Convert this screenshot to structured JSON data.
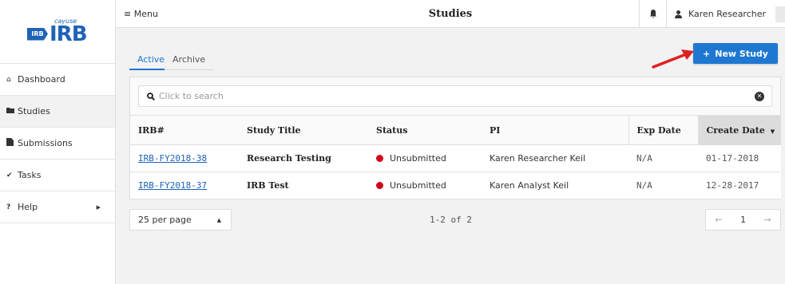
{
  "brand": {
    "tag": "IRB",
    "main": "IRB",
    "sub": "cayuse"
  },
  "sidebar": {
    "items": [
      {
        "label": "Dashboard",
        "icon": "home-icon"
      },
      {
        "label": "Studies",
        "icon": "folder-icon"
      },
      {
        "label": "Submissions",
        "icon": "document-icon"
      },
      {
        "label": "Tasks",
        "icon": "check-icon"
      },
      {
        "label": "Help",
        "icon": "question-icon"
      }
    ]
  },
  "header": {
    "menu_label": "Menu",
    "title": "Studies",
    "user_name": "Karen Researcher"
  },
  "tabs": {
    "active": "Active",
    "archive": "Archive"
  },
  "new_study_label": "New Study",
  "search": {
    "placeholder": "Click to search"
  },
  "table": {
    "headers": [
      "IRB#",
      "Study Title",
      "Status",
      "PI",
      "Exp Date",
      "Create Date"
    ],
    "rows": [
      {
        "irb": "IRB-FY2018-38",
        "title": "Research Testing",
        "status": "Unsubmitted",
        "pi": "Karen Researcher Keil",
        "exp": "N/A",
        "created": "01-17-2018"
      },
      {
        "irb": "IRB-FY2018-37",
        "title": "IRB Test",
        "status": "Unsubmitted",
        "pi": "Karen Analyst Keil",
        "exp": "N/A",
        "created": "12-28-2017"
      }
    ]
  },
  "footer": {
    "per_page": "25 per page",
    "range": "1-2 of 2",
    "page": "1"
  },
  "colors": {
    "accent": "#1e78d2",
    "status_unsubmitted": "#d0021b",
    "annotation_arrow": "#e02020"
  }
}
